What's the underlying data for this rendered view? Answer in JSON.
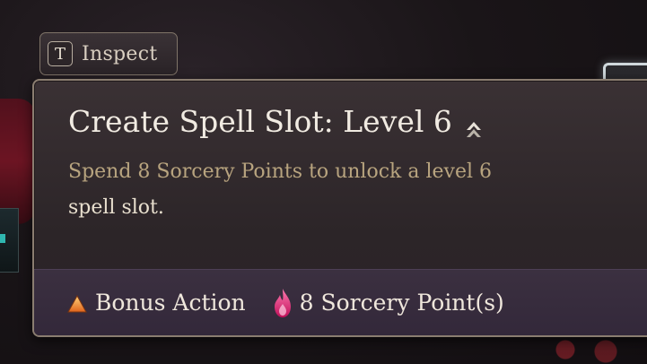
{
  "inspect": {
    "key": "T",
    "label": "Inspect"
  },
  "tooltip": {
    "title": "Create Spell Slot: Level 6",
    "description_line1": "Spend 8 Sorcery Points to unlock a level 6",
    "description_line2": "spell slot.",
    "costs": [
      {
        "icon": "bonus-action-triangle-icon",
        "label": "Bonus Action",
        "color": "#f08a2a"
      },
      {
        "icon": "sorcery-point-flame-icon",
        "label": "8 Sorcery Point(s)",
        "color": "#e0307a"
      }
    ]
  },
  "colors": {
    "title": "#f1ebe2",
    "description": "#b8a47f",
    "panel": "#2c2528",
    "footer": "#33283a",
    "border": "#8a7d70"
  }
}
